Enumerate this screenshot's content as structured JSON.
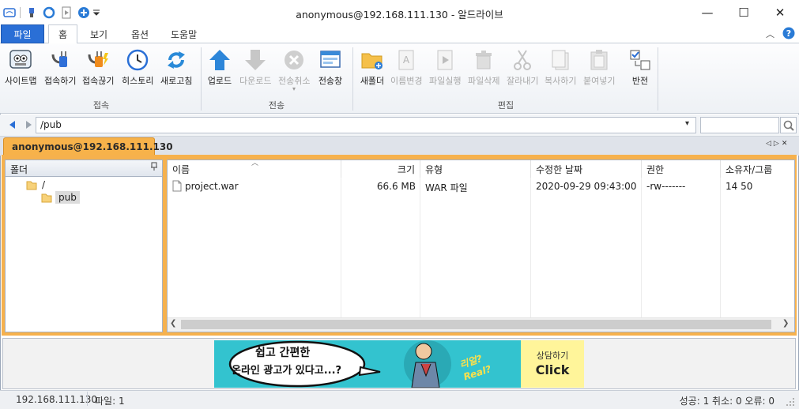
{
  "window": {
    "title": "anonymous@192.168.111.130 - 알드라이브",
    "minimize": "—",
    "maximize": "☐",
    "close": "✕"
  },
  "ribbon": {
    "tabs": [
      {
        "label": "파일"
      },
      {
        "label": "홈"
      },
      {
        "label": "보기"
      },
      {
        "label": "옵션"
      },
      {
        "label": "도움말"
      }
    ],
    "groups": {
      "connect": {
        "label": "접속",
        "buttons": [
          {
            "label": "사이트맵",
            "icon": "sitemap-icon"
          },
          {
            "label": "접속하기",
            "icon": "plug-icon"
          },
          {
            "label": "접속끊기",
            "icon": "unplug-icon"
          },
          {
            "label": "히스토리",
            "icon": "clock-icon"
          },
          {
            "label": "새로고침",
            "icon": "refresh-icon"
          }
        ]
      },
      "transfer": {
        "label": "전송",
        "buttons": [
          {
            "label": "업로드",
            "icon": "upload-icon"
          },
          {
            "label": "다운로드",
            "icon": "download-icon"
          },
          {
            "label": "전송취소",
            "icon": "cancel-icon"
          },
          {
            "label": "전송창",
            "icon": "transfer-window-icon"
          }
        ]
      },
      "edit": {
        "label": "편집",
        "buttons": [
          {
            "label": "새폴더",
            "icon": "new-folder-icon"
          },
          {
            "label": "이름변경",
            "icon": "rename-icon"
          },
          {
            "label": "파일실행",
            "icon": "run-file-icon"
          },
          {
            "label": "파일삭제",
            "icon": "trash-icon"
          },
          {
            "label": "잘라내기",
            "icon": "scissors-icon"
          },
          {
            "label": "복사하기",
            "icon": "copy-icon"
          },
          {
            "label": "붙여넣기",
            "icon": "paste-icon"
          },
          {
            "label": "반전",
            "icon": "invert-selection-icon"
          }
        ]
      }
    }
  },
  "address": {
    "path": "/pub",
    "dropdown": "▾",
    "search_placeholder": ""
  },
  "session": {
    "tab_label": "anonymous@192.168.111.130"
  },
  "folder_pane": {
    "header": "폴더",
    "pin": "ㅁ",
    "tree": [
      {
        "label": "/"
      },
      {
        "label": "pub",
        "selected": true
      }
    ]
  },
  "file_list": {
    "columns": [
      "이름",
      "크기",
      "유형",
      "수정한 날짜",
      "권한",
      "소유자/그룹"
    ],
    "rows": [
      {
        "name": "project.war",
        "size": "66.6 MB",
        "type": "WAR 파일",
        "modified": "2020-09-29 09:43:00",
        "perm": "-rw-------",
        "owner": "14 50"
      }
    ]
  },
  "ad": {
    "bubble_line1": "쉽고 간편한",
    "bubble_line2": "온라인 광고가 있다고...?",
    "real_text": "리얼? Real?",
    "cta_top": "상담하기",
    "cta_main": "Click"
  },
  "status": {
    "host": "192.168.111.130",
    "files": "파일: 1",
    "summary": "성공: 1 취소: 0 오류: 0"
  },
  "colors": {
    "accent": "#2a6fd6",
    "session_tab": "#f7b24a",
    "ad_bg": "#33c3cf",
    "ad_cta": "#fff59a"
  }
}
